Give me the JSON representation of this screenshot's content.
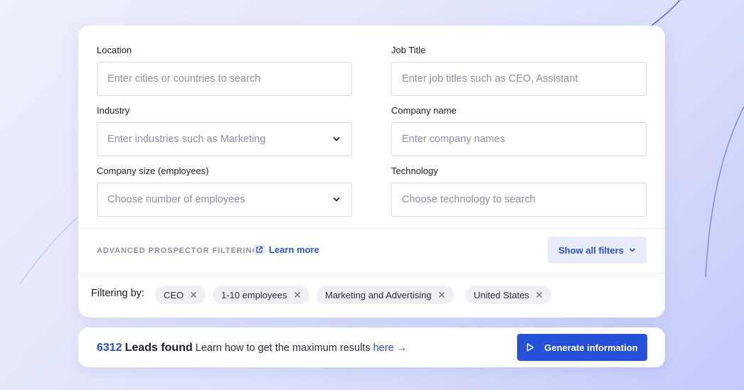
{
  "form": {
    "location": {
      "label": "Location",
      "placeholder": "Enter cities or countries to search"
    },
    "job_title": {
      "label": "Job Title",
      "placeholder": "Enter job titles such as CEO, Assistant"
    },
    "industry": {
      "label": "Industry",
      "placeholder": "Enter industries such as Marketing",
      "icon": "chevron-down-icon"
    },
    "company_name": {
      "label": "Company name",
      "placeholder": "Enter company names"
    },
    "company_size": {
      "label": "Company size (employees)",
      "placeholder": "Choose number of employees",
      "icon": "chevron-down-icon"
    },
    "technology": {
      "label": "Technology",
      "placeholder": "Choose technology to search"
    }
  },
  "advanced": {
    "title": "ADVANCED PROSPECTOR FILTERING",
    "learn_more": "Learn more",
    "learn_more_icon": "external-link-icon",
    "show_filters": "Show all filters",
    "show_filters_icon": "chevron-down-icon"
  },
  "filtering": {
    "label": "Filtering by:",
    "chips": [
      {
        "label": "CEO"
      },
      {
        "label": "1-10 employees"
      },
      {
        "label": "Marketing and Advertising"
      },
      {
        "label": "United States"
      }
    ],
    "remove_icon": "close-icon"
  },
  "results": {
    "count": "6312",
    "found_label": "Leads found",
    "hint": "Learn how to get the maximum results",
    "here_link": "here →",
    "generate_button": "Generate information",
    "generate_icon": "play-icon"
  },
  "colors": {
    "accent": "#2d4fd6",
    "button": "#2650d9",
    "chip_bg": "#eef0f4",
    "secondary_button_bg": "#e9ecfb"
  }
}
